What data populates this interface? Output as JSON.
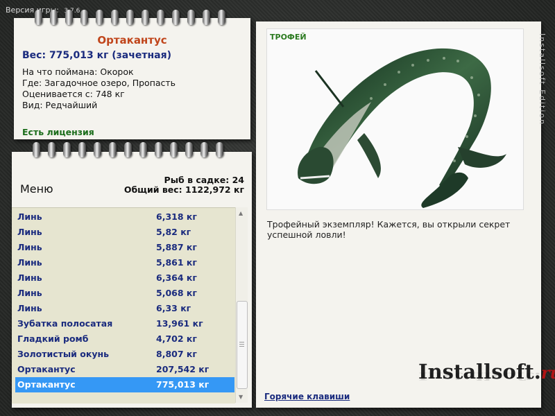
{
  "version": {
    "label": "Версия игры:",
    "number": "3.7.6"
  },
  "catch": {
    "name": "Ортакантус",
    "weight": "Вес: 775,013 кг (зачетная)",
    "bait": "На что поймана: Окорок",
    "place": "Где: Загадочное озеро, Пропасть",
    "value": "Оценивается с: 748 кг",
    "rarity": "Вид: Редчайший",
    "license": "Есть лицензия"
  },
  "list_header": {
    "menu": "Меню",
    "count": "Рыб в садке: 24",
    "total": "Общий вес: 1122,972 кг"
  },
  "fish_rows": [
    {
      "name": "Линь",
      "weight": "6,318 кг"
    },
    {
      "name": "Линь",
      "weight": "5,82 кг"
    },
    {
      "name": "Линь",
      "weight": "5,887 кг"
    },
    {
      "name": "Линь",
      "weight": "5,861 кг"
    },
    {
      "name": "Линь",
      "weight": "6,364 кг"
    },
    {
      "name": "Линь",
      "weight": "5,068 кг"
    },
    {
      "name": "Линь",
      "weight": "6,33 кг"
    },
    {
      "name": "Зубатка полосатая",
      "weight": "13,961 кг"
    },
    {
      "name": "Гладкий ромб",
      "weight": "4,702 кг"
    },
    {
      "name": "Золотистый окунь",
      "weight": "8,807 кг"
    },
    {
      "name": "Ортакантус",
      "weight": "207,542 кг"
    },
    {
      "name": "Ортакантус",
      "weight": "775,013 кг",
      "selected": true
    }
  ],
  "trophy": {
    "label": "ТРОФЕЙ",
    "description": "Трофейный экземпляр! Кажется, вы открыли секрет успешной ловли!",
    "hotkeys": "Горячие клавиши"
  },
  "brand": {
    "name": "Installsoft.",
    "tld": "ru"
  },
  "side_text": "Installsoft Edition",
  "colors": {
    "accent_blue": "#1a2b7e",
    "title_orange": "#c0451b",
    "license_green": "#1b6d1b",
    "selection": "#3598f5"
  }
}
